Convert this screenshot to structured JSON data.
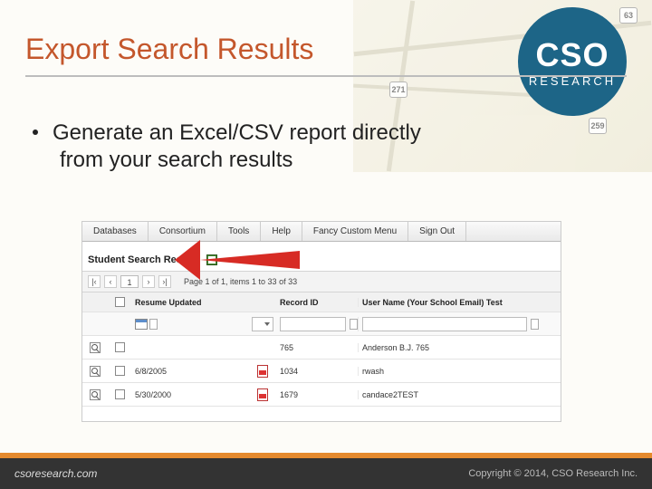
{
  "title": "Export Search Results",
  "bullet": {
    "line1": "Generate an Excel/CSV report directly",
    "line2": "from your search results"
  },
  "logo": {
    "main": "CSO",
    "sub": "RESEARCH"
  },
  "map_shields": [
    "63",
    "271",
    "259"
  ],
  "screenshot": {
    "menu": [
      "Databases",
      "Consortium",
      "Tools",
      "Help",
      "Fancy Custom Menu",
      "Sign Out"
    ],
    "section_title": "Student Search Results",
    "pager": {
      "first": "|‹",
      "prev": "‹",
      "page": "1",
      "next": "›",
      "last": "›|",
      "status": "Page 1 of 1, items 1 to 33 of 33"
    },
    "columns": [
      "Resume Updated",
      "Record ID",
      "User Name (Your School Email) Test"
    ],
    "rows": [
      {
        "date": "",
        "rid": "765",
        "uname": "Anderson B.J. 765"
      },
      {
        "date": "6/8/2005",
        "rid": "1034",
        "uname": "rwash"
      },
      {
        "date": "5/30/2000",
        "rid": "1679",
        "uname": "candace2TEST"
      }
    ]
  },
  "footer": {
    "site": "csoresearch.com",
    "copy": "Copyright © 2014, CSO Research Inc."
  }
}
